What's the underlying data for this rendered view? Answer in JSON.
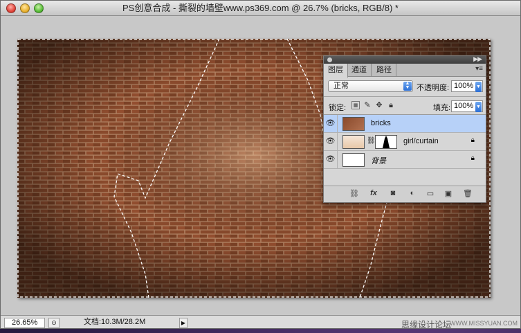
{
  "window": {
    "title": "PS创意合成 - 撕裂的墙壁www.ps369.com @ 26.7% (bricks, RGB/8) *"
  },
  "layers_panel": {
    "tabs": [
      {
        "label": "图层",
        "active": true
      },
      {
        "label": "通道",
        "active": false
      },
      {
        "label": "路径",
        "active": false
      }
    ],
    "blend_mode": "正常",
    "opacity_label": "不透明度:",
    "opacity_value": "100%",
    "lock_label": "锁定:",
    "fill_label": "填充:",
    "fill_value": "100%",
    "layers": [
      {
        "name": "bricks",
        "selected": true,
        "visible": true,
        "locked": false
      },
      {
        "name": "girl/curtain",
        "selected": false,
        "visible": true,
        "locked": true
      },
      {
        "name": "背景",
        "selected": false,
        "visible": true,
        "locked": true
      }
    ],
    "bottom_icons": [
      "link-icon",
      "fx-icon",
      "mask-icon",
      "adjustment-icon",
      "group-icon",
      "new-layer-icon",
      "trash-icon"
    ]
  },
  "status_bar": {
    "zoom": "26.65%",
    "doc_info": "文档:10.3M/28.2M"
  },
  "watermark": {
    "text1": "思缘设计论坛",
    "text2": "WWW.MISSYUAN.COM"
  },
  "colors": {
    "brick": "#8a4a2c",
    "mortar": "#b89878",
    "selection": "#b7d1f8",
    "desktop": "#2b1d45"
  }
}
